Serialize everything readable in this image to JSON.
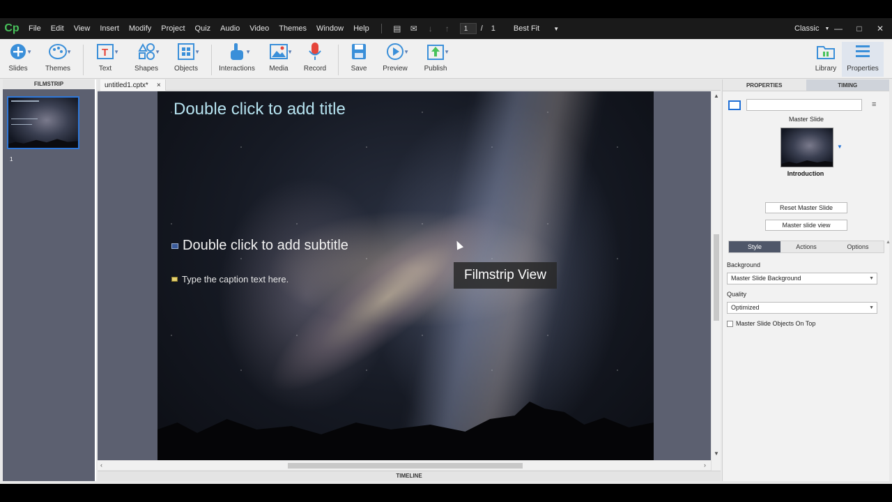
{
  "app": {
    "logo": "Cp"
  },
  "menu": [
    "File",
    "Edit",
    "View",
    "Insert",
    "Modify",
    "Project",
    "Quiz",
    "Audio",
    "Video",
    "Themes",
    "Window",
    "Help"
  ],
  "nav": {
    "page": "1",
    "separator": "/",
    "total": "1",
    "zoom": "Best Fit",
    "mode": "Classic"
  },
  "window_controls": {
    "minimize": "—",
    "maximize": "□",
    "close": "✕"
  },
  "toolbar": {
    "slides": "Slides",
    "themes": "Themes",
    "text": "Text",
    "shapes": "Shapes",
    "objects": "Objects",
    "interactions": "Interactions",
    "media": "Media",
    "record": "Record",
    "save": "Save",
    "preview": "Preview",
    "publish": "Publish",
    "library": "Library",
    "properties": "Properties"
  },
  "filmstrip": {
    "header": "FILMSTRIP",
    "slide_number": "1"
  },
  "doc_tab": {
    "name": "untitled1.cptx*",
    "close": "×"
  },
  "slide": {
    "title": "Double click to add title",
    "subtitle": "Double click to add subtitle",
    "caption": "Type the caption text here."
  },
  "tooltip": "Filmstrip View",
  "timeline": "TIMELINE",
  "panel": {
    "tab_properties": "PROPERTIES",
    "tab_timing": "TIMING",
    "name_value": "",
    "master_label": "Master Slide",
    "master_name": "Introduction",
    "reset_button": "Reset Master Slide",
    "view_button": "Master slide view",
    "subtabs": [
      "Style",
      "Actions",
      "Options"
    ],
    "background_label": "Background",
    "background_value": "Master Slide Background",
    "quality_label": "Quality",
    "quality_value": "Optimized",
    "checkbox_label": "Master Slide Objects On Top"
  },
  "colors": {
    "accent": "#1f6fd6",
    "title_text": "#b6e3f0",
    "filmstrip_bg": "#5c6070"
  }
}
